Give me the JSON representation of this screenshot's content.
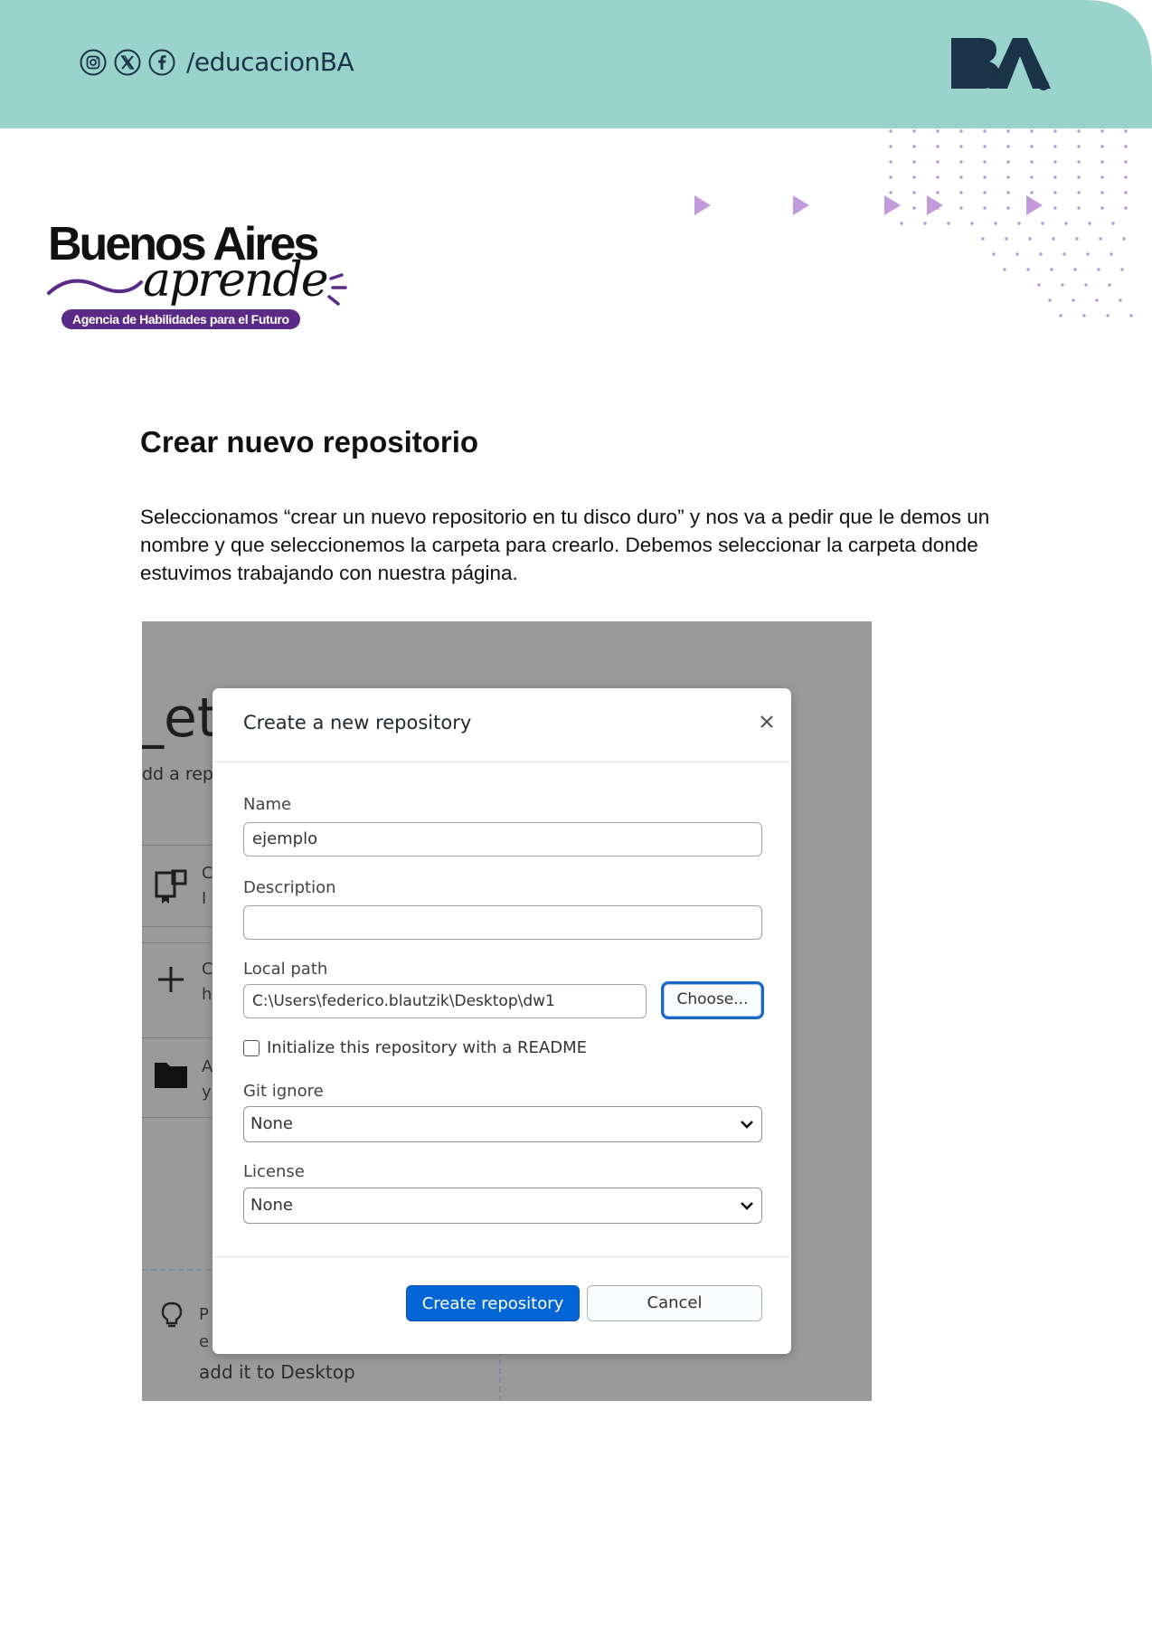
{
  "header": {
    "handle": "/educacionBA",
    "social_icons": [
      "instagram-icon",
      "x-icon",
      "facebook-icon"
    ],
    "logo_text": "BA",
    "band_color": "#99d3cc",
    "logo_color": "#1b3349"
  },
  "brand": {
    "name": "Buenos Aires",
    "script": "aprende",
    "tagline": "Agencia de Habilidades para el Futuro",
    "accent": "#5b2a86"
  },
  "content": {
    "title": "Crear nuevo repositorio",
    "paragraph": "Seleccionamos “crear un nuevo repositorio en tu disco duro” y nos va a pedir que le demos un nombre y que seleccionemos la carpeta para crearlo. Debemos seleccionar la carpeta donde estuvimos trabajando con nuestra página."
  },
  "screenshot": {
    "background_fragments": {
      "heading": "_et",
      "subtitle": "dd a repo",
      "row1_a": "C",
      "row1_b": "I",
      "row2_a": "C",
      "row2_b": "h",
      "row3_a": "A",
      "row3_b": "y",
      "hint_a": "P",
      "hint_b": "e",
      "hint_line": "add it to Desktop"
    },
    "dialog": {
      "title": "Create a new repository",
      "name_label": "Name",
      "name_value": "ejemplo",
      "description_label": "Description",
      "description_value": "",
      "local_path_label": "Local path",
      "local_path_value": "C:\\Users\\federico.blautzik\\Desktop\\dw1",
      "choose_label": "Choose...",
      "readme_label": "Initialize this repository with a README",
      "readme_checked": false,
      "gitignore_label": "Git ignore",
      "gitignore_value": "None",
      "license_label": "License",
      "license_value": "None",
      "create_label": "Create repository",
      "cancel_label": "Cancel",
      "primary_color": "#0366d6"
    }
  }
}
